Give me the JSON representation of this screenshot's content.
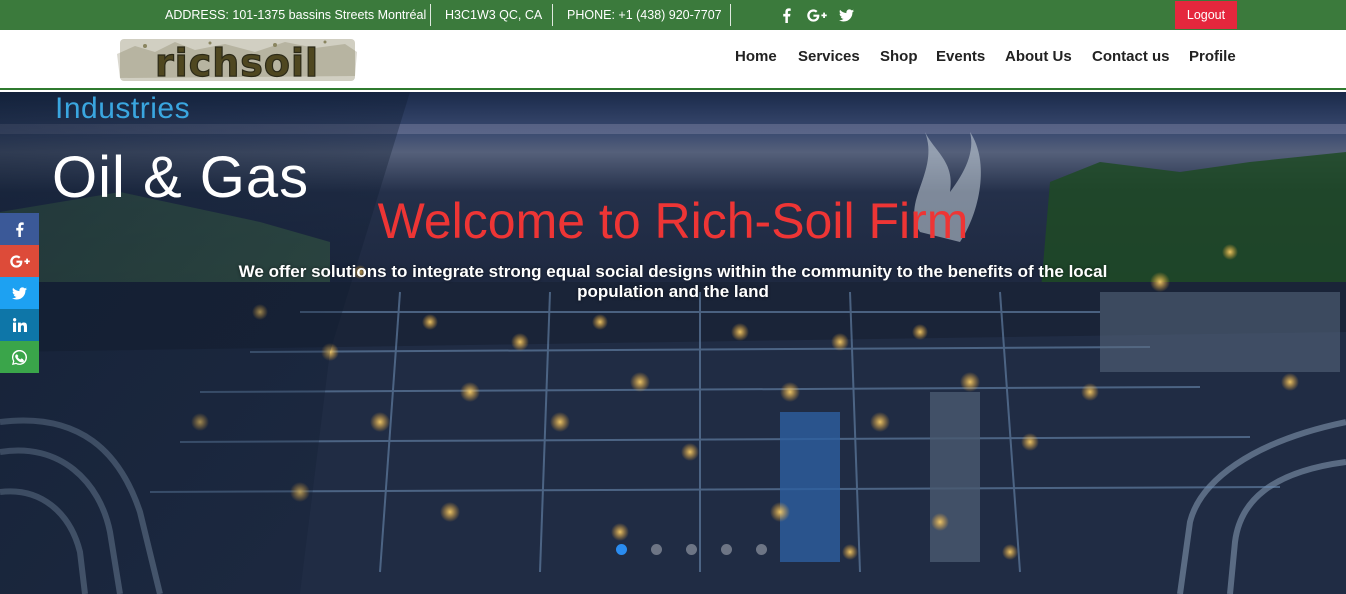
{
  "topbar": {
    "address": "ADDRESS: 101-1375 bassins Streets Montréal",
    "postal": "H3C1W3 QC, CA",
    "phone": "PHONE: +1 (438) 920-7707",
    "social_icons": [
      "facebook-icon",
      "google-plus-icon",
      "twitter-icon"
    ],
    "logout_label": "Logout"
  },
  "logo": {
    "text": "richsoil"
  },
  "nav": {
    "items": [
      {
        "label": "Home"
      },
      {
        "label": "Services"
      },
      {
        "label": "Shop"
      },
      {
        "label": "Events"
      },
      {
        "label": "About Us"
      },
      {
        "label": "Contact us"
      },
      {
        "label": "Profile"
      }
    ]
  },
  "hero": {
    "image_text_top": "Industries",
    "image_text_main": "Oil & Gas",
    "title": "Welcome to Rich-Soil Firm",
    "subtitle": "We offer solutions to integrate strong equal social designs within the community to the benefits of the local population and the land",
    "slides_count": 5,
    "active_slide": 1
  },
  "share_bar": {
    "buttons": [
      "facebook-icon",
      "google-plus-icon",
      "twitter-icon",
      "linkedin-icon",
      "whatsapp-icon"
    ]
  },
  "colors": {
    "topbar": "#3b7a3c",
    "logout": "#e5273d",
    "title": "#ee3535",
    "facebook": "#3b5998",
    "google_plus": "#dd4b39",
    "twitter": "#1da1f2",
    "linkedin": "#0e76a8",
    "whatsapp": "#3aa54a",
    "active_dot": "#2a8cf0"
  }
}
